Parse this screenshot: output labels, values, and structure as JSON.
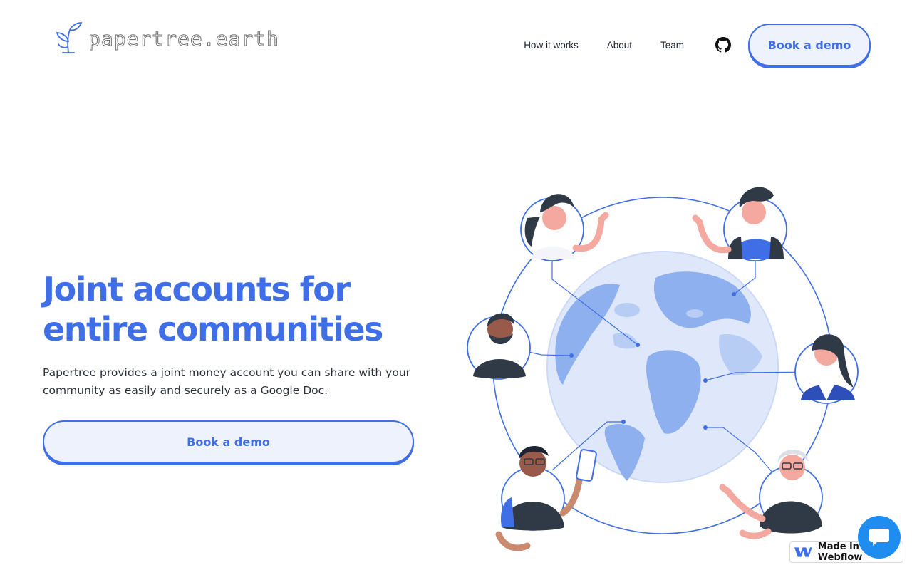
{
  "header": {
    "logo_text": "papertree.earth",
    "nav": [
      "How it works",
      "About",
      "Team"
    ],
    "cta_label": "Book a demo",
    "github_icon": "github-icon"
  },
  "hero": {
    "title_line1": "Joint accounts for",
    "title_line2": "entire communities",
    "subtitle": "Papertree provides a joint money account you can share with your community as easily and securely as a Google Doc.",
    "cta_label": "Book a demo"
  },
  "illustration": {
    "description_icon": "globe-community-illustration"
  },
  "badge": {
    "text": "Made in Webflow"
  },
  "chat_widget": {
    "icon": "chat-bubble-icon"
  },
  "colors": {
    "accent": "#3f6ee6",
    "accent_light": "#eef2fd",
    "globe_dark": "#8fb0ee",
    "globe_light": "#dfe8fb",
    "chat": "#1f8cf0"
  }
}
